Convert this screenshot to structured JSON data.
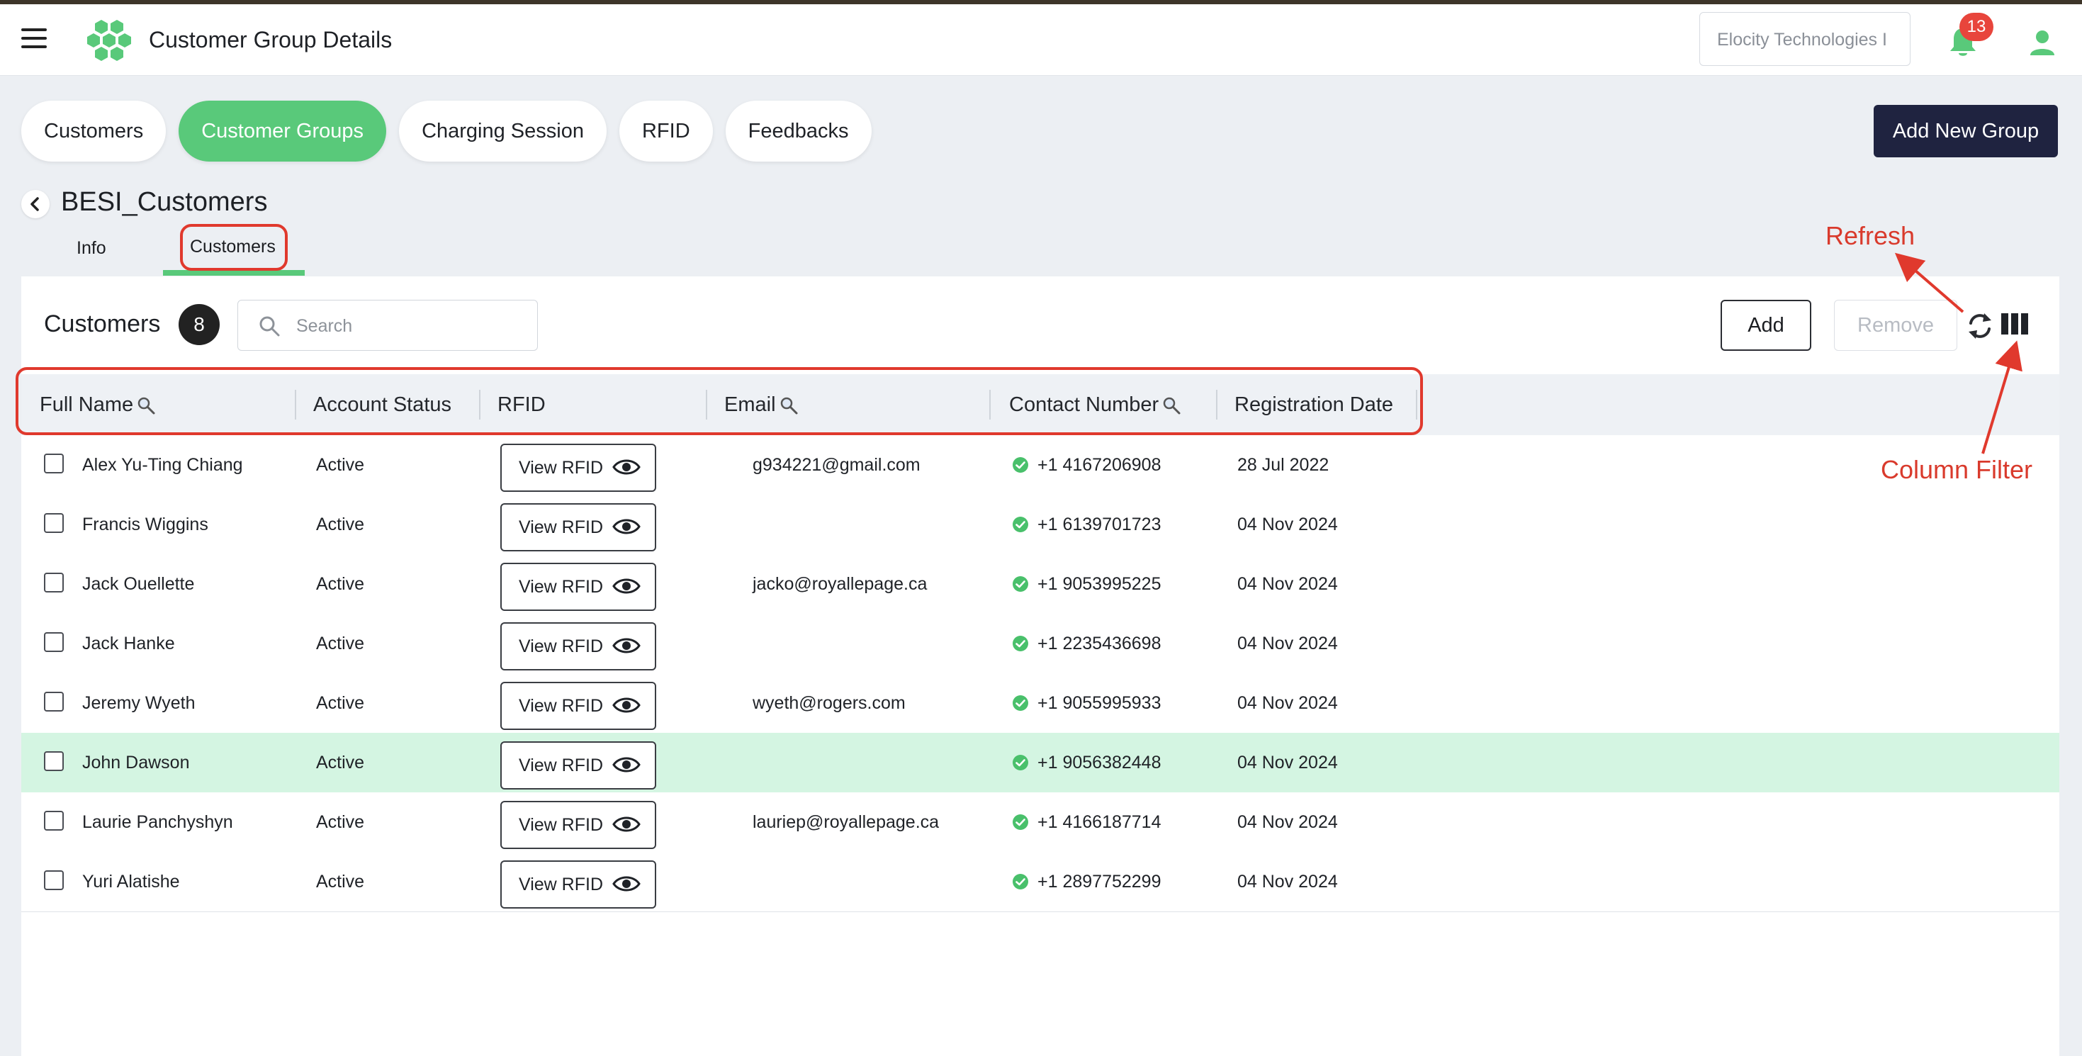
{
  "app": {
    "title": "Customer Group Details",
    "org_selector": "Elocity Technologies I",
    "notification_count": "13"
  },
  "nav_tabs": [
    {
      "label": "Customers",
      "active": false
    },
    {
      "label": "Customer Groups",
      "active": true
    },
    {
      "label": "Charging Session",
      "active": false
    },
    {
      "label": "RFID",
      "active": false
    },
    {
      "label": "Feedbacks",
      "active": false
    }
  ],
  "add_group_label": "Add New Group",
  "group": {
    "name": "BESI_Customers",
    "subtabs": [
      {
        "label": "Info",
        "active": false
      },
      {
        "label": "Customers",
        "active": true
      }
    ]
  },
  "customers": {
    "title": "Customers",
    "count": "8",
    "search_placeholder": "Search",
    "add_label": "Add",
    "remove_label": "Remove",
    "columns": [
      "Full Name",
      "Account Status",
      "RFID",
      "Email",
      "Contact Number",
      "Registration Date"
    ],
    "rfid_button_label": "View RFID",
    "rows": [
      {
        "name": "Alex Yu-Ting Chiang",
        "status": "Active",
        "email": "g934221@gmail.com",
        "phone": "+1 4167206908",
        "date": "28 Jul 2022",
        "highlighted": false
      },
      {
        "name": "Francis Wiggins",
        "status": "Active",
        "email": "",
        "phone": "+1 6139701723",
        "date": "04 Nov 2024",
        "highlighted": false
      },
      {
        "name": "Jack Ouellette",
        "status": "Active",
        "email": "jacko@royallepage.ca",
        "phone": "+1 9053995225",
        "date": "04 Nov 2024",
        "highlighted": false
      },
      {
        "name": "Jack Hanke",
        "status": "Active",
        "email": "",
        "phone": "+1 2235436698",
        "date": "04 Nov 2024",
        "highlighted": false
      },
      {
        "name": "Jeremy Wyeth",
        "status": "Active",
        "email": "wyeth@rogers.com",
        "phone": "+1 9055995933",
        "date": "04 Nov 2024",
        "highlighted": false
      },
      {
        "name": "John Dawson",
        "status": "Active",
        "email": "",
        "phone": "+1 9056382448",
        "date": "04 Nov 2024",
        "highlighted": true
      },
      {
        "name": "Laurie Panchyshyn",
        "status": "Active",
        "email": "lauriep@royallepage.ca",
        "phone": "+1 4166187714",
        "date": "04 Nov 2024",
        "highlighted": false
      },
      {
        "name": "Yuri Alatishe",
        "status": "Active",
        "email": "",
        "phone": "+1 2897752299",
        "date": "04 Nov 2024",
        "highlighted": false
      }
    ]
  },
  "annotations": {
    "refresh": "Refresh",
    "column_filter": "Column Filter"
  },
  "colors": {
    "accent": "#59c97a",
    "dark_button": "#1f2340",
    "annotation": "#d93a2c",
    "row_highlight": "#d4f5e2"
  },
  "icons": [
    "hamburger-icon",
    "logo-icon",
    "bell-icon",
    "user-icon",
    "back-icon",
    "search-icon",
    "refresh-icon",
    "columns-icon",
    "eye-icon",
    "check-circle-icon"
  ]
}
